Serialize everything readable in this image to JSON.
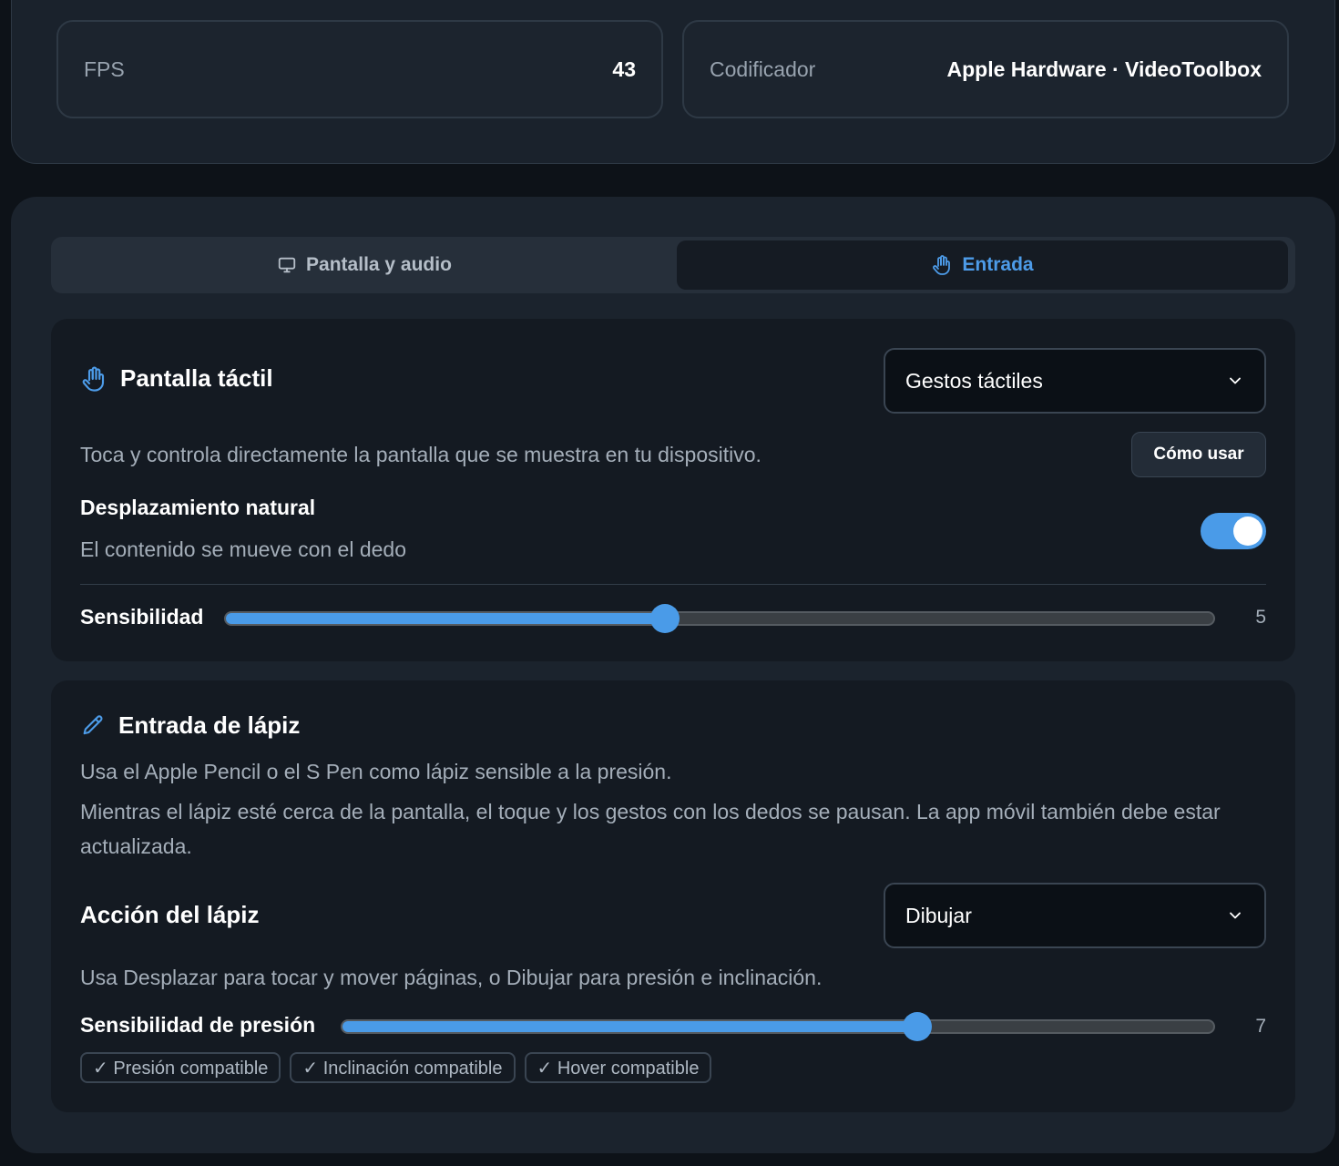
{
  "stats": {
    "fps": {
      "label": "FPS",
      "value": "43"
    },
    "encoder": {
      "label": "Codificador",
      "value": "Apple Hardware · VideoToolbox"
    }
  },
  "tabs": [
    {
      "label": "Pantalla y audio",
      "icon": "monitor-icon",
      "active": false
    },
    {
      "label": "Entrada",
      "icon": "hand-icon",
      "active": true
    }
  ],
  "touch": {
    "title": "Pantalla táctil",
    "icon": "hand-icon",
    "mode": "Gestos táctiles",
    "description": "Toca y controla directamente la pantalla que se muestra en tu dispositivo.",
    "how_to_label": "Cómo usar",
    "natural_scroll": {
      "label": "Desplazamiento natural",
      "hint": "El contenido se mueve con el dedo",
      "enabled": true
    },
    "sensitivity": {
      "label": "Sensibilidad",
      "value": "5",
      "fraction": 0.445
    }
  },
  "pencil": {
    "title": "Entrada de lápiz",
    "icon": "pencil-icon",
    "description1": "Usa el Apple Pencil o el S Pen como lápiz sensible a la presión.",
    "description2": "Mientras el lápiz esté cerca de la pantalla, el toque y los gestos con los dedos se pausan. La app móvil también debe estar actualizada.",
    "action": {
      "label": "Acción del lápiz",
      "value": "Dibujar",
      "hint": "Usa Desplazar para tocar y mover páginas, o Dibujar para presión e inclinación."
    },
    "pressure": {
      "label": "Sensibilidad de presión",
      "value": "7",
      "fraction": 0.66
    },
    "badges": [
      "✓ Presión compatible",
      "✓ Inclinación compatible",
      "✓ Hover compatible"
    ]
  },
  "colors": {
    "accent": "#4a9be8",
    "background": "#0d1218",
    "card": "#1b232d",
    "section": "#141a22"
  }
}
